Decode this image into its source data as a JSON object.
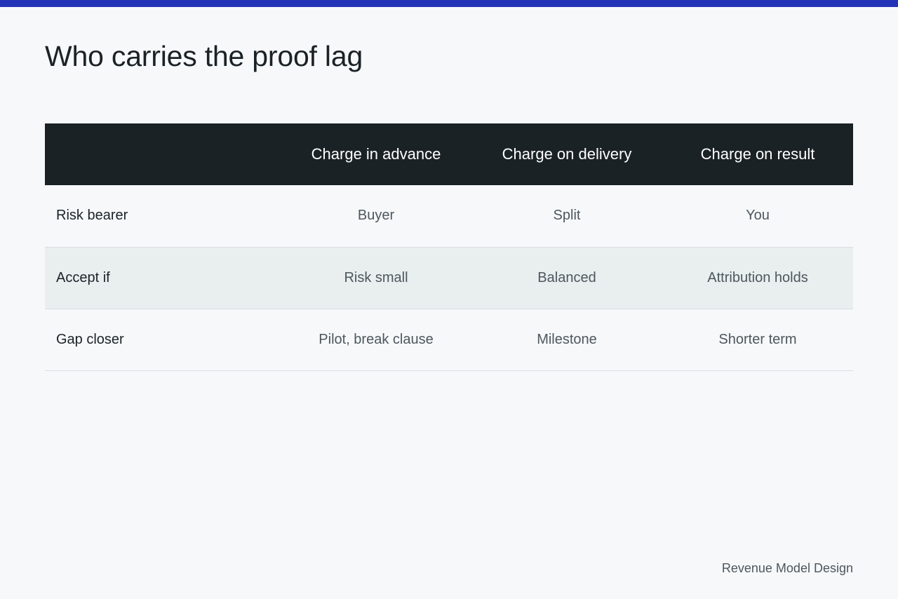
{
  "colors": {
    "accent_bar": "#2434b8",
    "header_bg": "#1b2226",
    "page_bg": "#f6f8fa",
    "alt_row_bg": "#e9eeef"
  },
  "page": {
    "title": "Who carries the proof lag",
    "footer": "Revenue Model Design"
  },
  "table": {
    "corner": "",
    "columns": [
      "Charge in advance",
      "Charge on delivery",
      "Charge on result"
    ],
    "rows": [
      {
        "label": "Risk bearer",
        "cells": [
          "Buyer",
          "Split",
          "You"
        ]
      },
      {
        "label": "Accept if",
        "cells": [
          "Risk small",
          "Balanced",
          "Attribution holds"
        ]
      },
      {
        "label": "Gap closer",
        "cells": [
          "Pilot, break clause",
          "Milestone",
          "Shorter term"
        ]
      }
    ]
  }
}
